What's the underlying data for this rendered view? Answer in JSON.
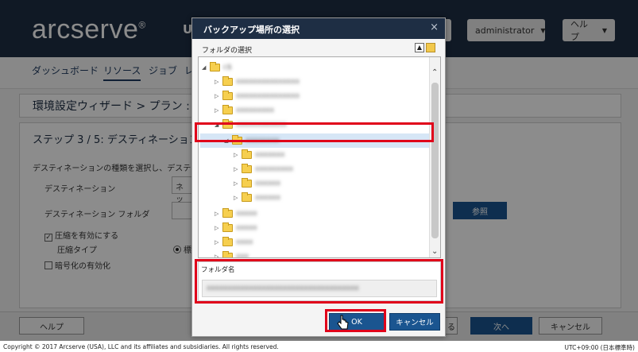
{
  "app": {
    "brand": "arcserve",
    "brand_mark": "®",
    "top_partial": "U",
    "user_menu": "administrator",
    "help_menu": "ヘルプ"
  },
  "nav": {
    "items": [
      "ダッシュボード",
      "リソース",
      "ジョブ",
      "レ"
    ],
    "active": "リソース"
  },
  "wizard": {
    "title": "環境設定ウィザード > プラン :",
    "step_title": "ステップ 3 / 5: デスティネーションの選択",
    "description": "デスティネーションの種類を選択し、デスティネーショ",
    "destination_label": "デスティネーション",
    "destination_value": "ネッ",
    "dest_folder_label": "デスティネーション フォルダ",
    "browse_button": "参照",
    "compress_label": "圧縮を有効にする",
    "compress_checked": true,
    "compress_type_label": "圧縮タイプ",
    "compress_type_value": "標",
    "encrypt_label": "暗号化の有効化",
    "encrypt_checked": false
  },
  "footer": {
    "help": "ヘルプ",
    "back_partial": "る",
    "next": "次へ",
    "cancel": "キャンセル",
    "copyright": "Copyright © 2017 Arcserve (USA), LLC and its affiliates and subsidiaries. All rights reserved.",
    "timezone": "UTC+09:00 (日本標準時)"
  },
  "dialog": {
    "title": "バックアップ場所の選択",
    "close_glyph": "×",
    "folder_select_label": "フォルダの選択",
    "tree": [
      {
        "label": "c$",
        "depth": 0,
        "expanded": true
      },
      {
        "label": "xxxxxxxxxxxxxxx",
        "depth": 1,
        "expanded": false
      },
      {
        "label": "xxxxxxxxxxxxxxx",
        "depth": 1,
        "expanded": false
      },
      {
        "label": "xxxxxxxxx",
        "depth": 1,
        "expanded": false
      },
      {
        "label": "xxxxxxxxxxxx",
        "depth": 1,
        "expanded": true
      },
      {
        "label": "xxxxxxxx",
        "depth": 2,
        "expanded": true,
        "selected": true
      },
      {
        "label": "xxxxxxx",
        "depth": 3,
        "expanded": false
      },
      {
        "label": "xxxxxxxxx",
        "depth": 3,
        "expanded": false
      },
      {
        "label": "xxxxxx",
        "depth": 3,
        "expanded": false
      },
      {
        "label": "xxxxxx",
        "depth": 3,
        "expanded": false
      },
      {
        "label": "xxxxx",
        "depth": 1,
        "expanded": false
      },
      {
        "label": "xxxxx",
        "depth": 1,
        "expanded": false
      },
      {
        "label": "xxxx",
        "depth": 1,
        "expanded": false
      },
      {
        "label": "xxx",
        "depth": 1,
        "expanded": false
      },
      {
        "label": "xxxxxxxx",
        "depth": 1,
        "expanded": false
      },
      {
        "label": "xxx",
        "depth": 1,
        "expanded": false
      }
    ],
    "folder_name_label": "フォルダ名",
    "folder_name_value": "xxxxxxxxxxxxxxxxxxxxxxxxxxxxxxxxxxxx",
    "ok_button": "OK",
    "cancel_button": "キャンセル"
  },
  "colors": {
    "header": "#1e2e44",
    "primary_button": "#1a5590",
    "highlight": "#e0001a",
    "folder": "#f6cf4f"
  }
}
